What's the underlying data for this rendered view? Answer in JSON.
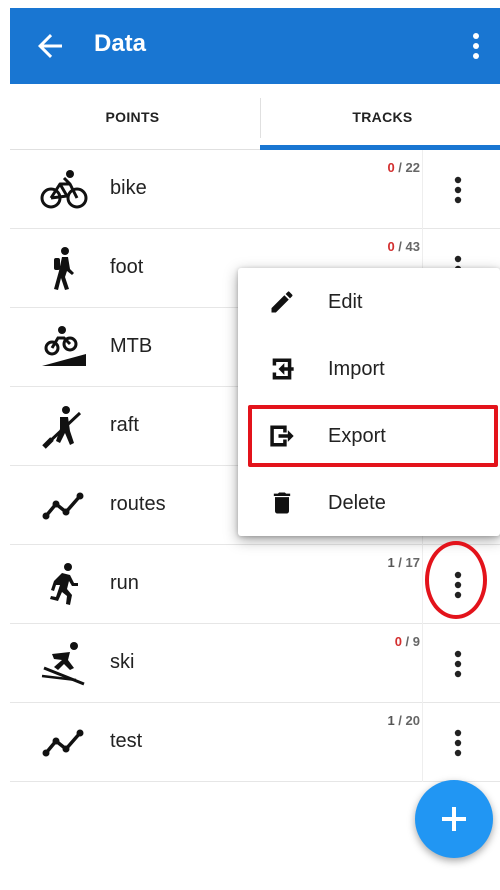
{
  "app_bar": {
    "title": "Data",
    "back_icon": "arrow-left-icon",
    "more_icon": "more-vertical-icon",
    "color": "#1976d2"
  },
  "tabs": [
    {
      "label": "POINTS",
      "selected": false
    },
    {
      "label": "TRACKS",
      "selected": true
    }
  ],
  "tracks": [
    {
      "name": "bike",
      "icon": "bicycle-icon",
      "visible": "0",
      "total": "22"
    },
    {
      "name": "foot",
      "icon": "hiker-icon",
      "visible": "0",
      "total": "43"
    },
    {
      "name": "MTB",
      "icon": "mountain-bike-icon",
      "visible": "",
      "total": ""
    },
    {
      "name": "raft",
      "icon": "raft-icon",
      "visible": "",
      "total": ""
    },
    {
      "name": "routes",
      "icon": "route-line-icon",
      "visible": "",
      "total": ""
    },
    {
      "name": "run",
      "icon": "runner-icon",
      "visible": "1",
      "total": "17"
    },
    {
      "name": "ski",
      "icon": "skier-icon",
      "visible": "0",
      "total": "9"
    },
    {
      "name": "test",
      "icon": "route-line-icon",
      "visible": "1",
      "total": "20"
    }
  ],
  "context_menu": {
    "items": [
      {
        "label": "Edit",
        "icon": "pencil-icon"
      },
      {
        "label": "Import",
        "icon": "import-icon"
      },
      {
        "label": "Export",
        "icon": "export-icon"
      },
      {
        "label": "Delete",
        "icon": "trash-icon"
      }
    ]
  },
  "fab": {
    "icon": "plus-icon",
    "color": "#2196f3"
  },
  "highlight_color": "#e3131b"
}
